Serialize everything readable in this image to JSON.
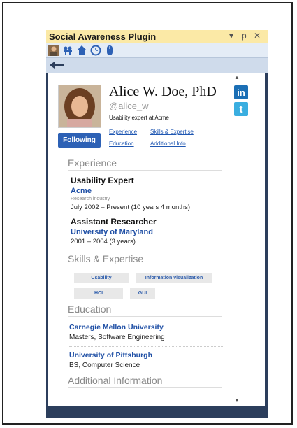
{
  "window": {
    "title": "Social Awareness Plugin",
    "controls": [
      "▾",
      "ᵽ",
      "✕"
    ]
  },
  "toolbar": {
    "icons": [
      "user-icon",
      "people-icon",
      "home-icon",
      "clock-icon",
      "mouse-icon"
    ]
  },
  "profile": {
    "name": "Alice W. Doe, PhD",
    "handle": "@alice_w",
    "headline": "Usability expert at Acme",
    "follow_label": "Following",
    "links": [
      "Experience",
      "Skills & Expertise",
      "Education",
      "Additional Info"
    ],
    "social": {
      "linkedin": "in",
      "twitter": "t"
    }
  },
  "sections": {
    "experience": "Experience",
    "skills": "Skills & Expertise",
    "education": "Education",
    "additional": "Additional Information"
  },
  "experience": [
    {
      "title": "Usability Expert",
      "org": "Acme",
      "industry": "Research industry",
      "dates": "July 2002 – Present (10 years 4 months)"
    },
    {
      "title": "Assistant  Researcher",
      "org": "University of Maryland",
      "dates": "2001 – 2004 (3 years)"
    }
  ],
  "skills": [
    "Usability",
    "Information visualization",
    "HCI",
    "GUI"
  ],
  "education": [
    {
      "school": "Carnegie Mellon University",
      "degree": "Masters, Software Engineering"
    },
    {
      "school": "University of Pittsburgh",
      "degree": "BS, Computer Science"
    }
  ],
  "colors": {
    "titlebar": "#fbe9a6",
    "panel": "#2c3e5c",
    "link": "#1f57b2",
    "button": "#2d61b5"
  }
}
